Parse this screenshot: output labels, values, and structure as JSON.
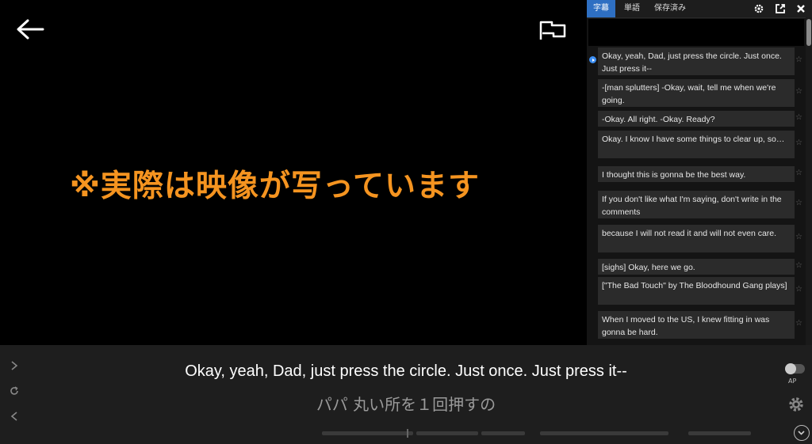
{
  "video": {
    "overlay_note": "※実際は映像が写っています"
  },
  "panel": {
    "tabs": [
      {
        "label": "字幕",
        "active": true
      },
      {
        "label": "単語",
        "active": false
      },
      {
        "label": "保存済み",
        "active": false
      }
    ],
    "toolbar_icons": [
      "gear-icon",
      "export-icon",
      "close-icon"
    ],
    "subtitles": [
      {
        "text": "Okay, yeah, Dad, just press the circle. Just once. Just press it--",
        "playing": true
      },
      {
        "text": "-[man splutters] -Okay, wait, tell me when we're going.",
        "playing": false
      },
      {
        "text": "-Okay. All right. -Okay. Ready?",
        "playing": false
      },
      {
        "text": "Okay. I know I have some things to clear up, so…",
        "playing": false
      },
      {
        "text": "I thought this is gonna be the best way.",
        "playing": false
      },
      {
        "text": "If you don't like what I'm saying, don't write in the comments",
        "playing": false
      },
      {
        "text": "because I will not read it and will not even care.",
        "playing": false
      },
      {
        "text": "[sighs] Okay, here we go.",
        "playing": false
      },
      {
        "text": "[\"The Bad Touch\" by The Bloodhound Gang plays]",
        "playing": false
      },
      {
        "text": "When I moved to the US, I knew fitting in was gonna be hard.",
        "playing": false
      }
    ],
    "star_glyph": "☆"
  },
  "player": {
    "subtitle_en": "Okay, yeah, Dad, just press the circle. Just once. Just press it--",
    "subtitle_ja": "パパ 丸い所を１回押すの",
    "ap_label": "AP",
    "colors": {
      "accent": "#2e6fc2",
      "overlay": "#f59420"
    }
  }
}
